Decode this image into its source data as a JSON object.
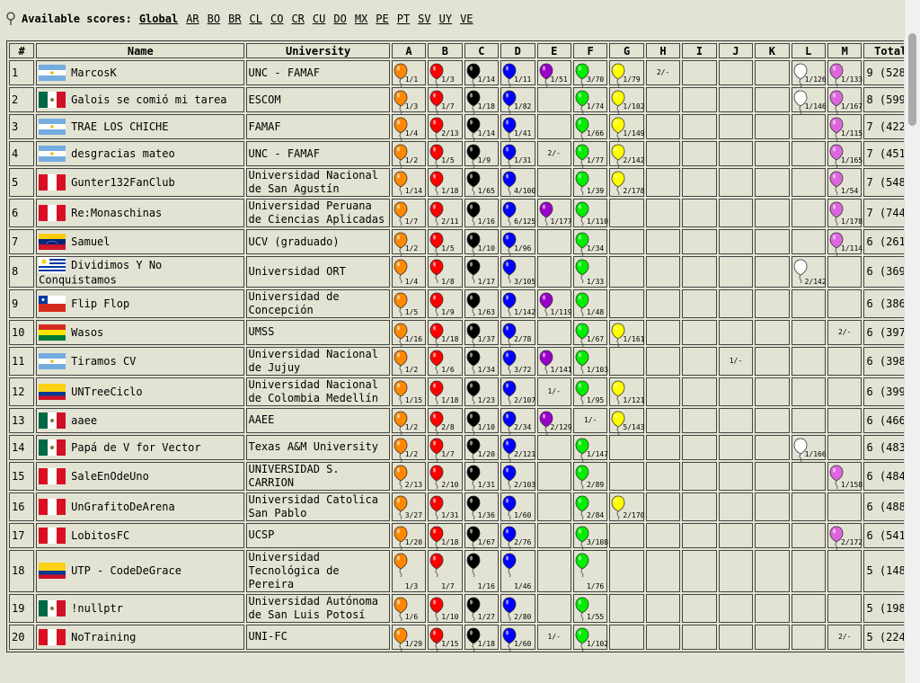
{
  "header": {
    "label": "Available scores:",
    "scores": [
      "Global",
      "AR",
      "BO",
      "BR",
      "CL",
      "CO",
      "CR",
      "CU",
      "DO",
      "MX",
      "PE",
      "PT",
      "SV",
      "UY",
      "VE"
    ],
    "selected": "Global"
  },
  "columns": {
    "rank": "#",
    "name": "Name",
    "university": "University",
    "problems": [
      "A",
      "B",
      "C",
      "D",
      "E",
      "F",
      "G",
      "H",
      "I",
      "J",
      "K",
      "L",
      "M"
    ],
    "total": "Total"
  },
  "balloon_colors": {
    "A": "#ff8800",
    "B": "#ff0000",
    "C": "#000000",
    "D": "#0000ff",
    "E": "#9900cc",
    "F": "#00ee00",
    "G": "#ffff00",
    "L": "#ffffff",
    "M": "#dd66dd"
  },
  "rows": [
    {
      "rank": "1",
      "flag": "AR",
      "name": "MarcosK",
      "university": [
        "UNC - FAMAF"
      ],
      "cells": {
        "A": "1/1",
        "B": "1/3",
        "C": "1/14",
        "D": "1/11",
        "E": "1/51",
        "F": "3/70",
        "G": "1/79",
        "H": "2/-",
        "L": "1/126",
        "M": "1/133"
      },
      "total": "9 (528)"
    },
    {
      "rank": "2",
      "flag": "MX",
      "name": "Galois se comió mi tarea",
      "university": [
        "ESCOM"
      ],
      "cells": {
        "A": "1/3",
        "B": "1/7",
        "C": "1/18",
        "D": "1/82",
        "F": "1/74",
        "G": "1/102",
        "L": "1/146",
        "M": "1/167"
      },
      "total": "8 (599)"
    },
    {
      "rank": "3",
      "flag": "AR",
      "name": "TRAE LOS CHICHE",
      "university": [
        "FAMAF"
      ],
      "cells": {
        "A": "1/4",
        "B": "2/13",
        "C": "1/14",
        "D": "1/41",
        "F": "1/66",
        "G": "1/149",
        "M": "1/115"
      },
      "total": "7 (422)"
    },
    {
      "rank": "4",
      "flag": "AR",
      "name": "desgracias mateo",
      "university": [
        "UNC - FAMAF"
      ],
      "cells": {
        "A": "1/2",
        "B": "1/5",
        "C": "1/9",
        "D": "1/31",
        "E": "2/-",
        "F": "1/77",
        "G": "2/142",
        "M": "1/165"
      },
      "total": "7 (451)"
    },
    {
      "rank": "5",
      "flag": "PE",
      "name": "Gunter132FanClub",
      "university": [
        "Universidad Nacional",
        "de San Agustín"
      ],
      "cells": {
        "A": "1/14",
        "B": "1/18",
        "C": "1/65",
        "D": "4/100",
        "F": "1/39",
        "G": "2/178",
        "M": "1/54"
      },
      "total": "7 (548)"
    },
    {
      "rank": "6",
      "flag": "PE",
      "name": "Re:Monaschinas",
      "university": [
        "Universidad Peruana",
        "de Ciencias Aplicadas"
      ],
      "cells": {
        "A": "1/7",
        "B": "2/11",
        "C": "1/16",
        "D": "6/125",
        "E": "1/177",
        "F": "1/110",
        "M": "1/178"
      },
      "total": "7 (744)"
    },
    {
      "rank": "7",
      "flag": "VE",
      "name": "Samuel",
      "university": [
        "UCV (graduado)"
      ],
      "cells": {
        "A": "1/2",
        "B": "1/5",
        "C": "1/10",
        "D": "1/96",
        "F": "1/34",
        "M": "1/114"
      },
      "total": "6 (261)"
    },
    {
      "rank": "8",
      "flag": "UY",
      "name": "Dividimos Y No Conquistamos",
      "university": [
        "Universidad ORT"
      ],
      "cells": {
        "A": "1/4",
        "B": "1/8",
        "C": "1/17",
        "D": "3/105",
        "F": "1/33",
        "L": "2/142"
      },
      "total": "6 (369)"
    },
    {
      "rank": "9",
      "flag": "CL",
      "name": "Flip Flop",
      "university": [
        "Universidad de",
        "Concepción"
      ],
      "cells": {
        "A": "1/5",
        "B": "1/9",
        "C": "1/63",
        "D": "1/142",
        "E": "1/119",
        "F": "1/48"
      },
      "total": "6 (386)"
    },
    {
      "rank": "10",
      "flag": "BO",
      "name": "Wasos",
      "university": [
        "UMSS"
      ],
      "cells": {
        "A": "1/16",
        "B": "1/18",
        "C": "1/37",
        "D": "2/78",
        "F": "1/67",
        "G": "1/161",
        "M": "2/-"
      },
      "total": "6 (397)"
    },
    {
      "rank": "11",
      "flag": "AR",
      "name": "Tiramos CV",
      "university": [
        "Universidad Nacional",
        "de Jujuy"
      ],
      "cells": {
        "A": "1/2",
        "B": "1/6",
        "C": "1/34",
        "D": "3/72",
        "E": "1/141",
        "F": "1/103",
        "J": "1/-"
      },
      "total": "6 (398)"
    },
    {
      "rank": "12",
      "flag": "CO",
      "name": "UNTreeCiclo",
      "university": [
        "Universidad Nacional",
        "de Colombia Medellín"
      ],
      "cells": {
        "A": "1/15",
        "B": "1/18",
        "C": "1/23",
        "D": "2/107",
        "E": "1/-",
        "F": "1/95",
        "G": "1/121"
      },
      "total": "6 (399)"
    },
    {
      "rank": "13",
      "flag": "MX",
      "name": "aaee",
      "university": [
        "AAEE"
      ],
      "cells": {
        "A": "1/2",
        "B": "2/8",
        "C": "1/10",
        "D": "2/34",
        "E": "2/129",
        "F": "1/-",
        "G": "5/143"
      },
      "total": "6 (466)"
    },
    {
      "rank": "14",
      "flag": "MX",
      "name": "Papá de V for Vector",
      "university": [
        "Texas A&M University"
      ],
      "cells": {
        "A": "1/2",
        "B": "1/7",
        "C": "1/20",
        "D": "2/121",
        "F": "1/147",
        "L": "1/166"
      },
      "total": "6 (483)"
    },
    {
      "rank": "15",
      "flag": "PE",
      "name": "SaleEnOdeUno",
      "university": [
        "UNIVERSIDAD S.",
        "CARRION"
      ],
      "cells": {
        "A": "2/13",
        "B": "2/10",
        "C": "1/31",
        "D": "2/103",
        "F": "2/89",
        "M": "1/158"
      },
      "total": "6 (484)"
    },
    {
      "rank": "16",
      "flag": "PE",
      "name": "UnGrafitoDeArena",
      "university": [
        "Universidad Catolica",
        "San Pablo"
      ],
      "cells": {
        "A": "3/27",
        "B": "1/31",
        "C": "1/36",
        "D": "1/60",
        "F": "2/84",
        "G": "2/170"
      },
      "total": "6 (488)"
    },
    {
      "rank": "17",
      "flag": "PE",
      "name": "LobitosFC",
      "university": [
        "UCSP"
      ],
      "cells": {
        "A": "1/20",
        "B": "1/18",
        "C": "1/67",
        "D": "2/76",
        "F": "3/108",
        "M": "2/172"
      },
      "total": "6 (541)"
    },
    {
      "rank": "18",
      "flag": "CO",
      "name": "UTP - CodeDeGrace",
      "university": [
        "Universidad",
        "Tecnológica de",
        "Pereira"
      ],
      "cells": {
        "A": "1/3",
        "B": "1/7",
        "C": "1/16",
        "D": "1/46",
        "F": "1/76"
      },
      "total": "5 (148)"
    },
    {
      "rank": "19",
      "flag": "MX",
      "name": "!nullptr",
      "university": [
        "Universidad Autónoma",
        "de San Luis Potosí"
      ],
      "cells": {
        "A": "1/6",
        "B": "1/10",
        "C": "1/27",
        "D": "2/80",
        "F": "1/55"
      },
      "total": "5 (198)"
    },
    {
      "rank": "20",
      "flag": "PE",
      "name": "NoTraining",
      "university": [
        "UNI-FC"
      ],
      "cells": {
        "A": "1/29",
        "B": "1/15",
        "C": "1/18",
        "D": "1/60",
        "E": "1/-",
        "F": "1/102",
        "M": "2/-"
      },
      "total": "5 (224)"
    }
  ]
}
